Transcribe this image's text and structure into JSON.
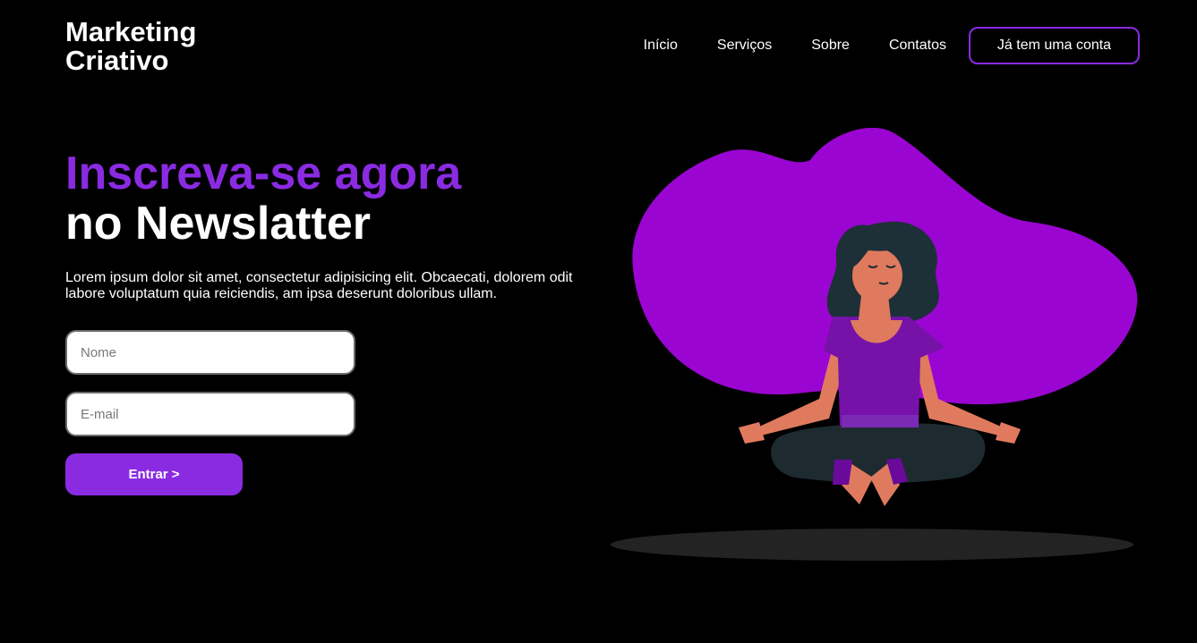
{
  "brand": {
    "line1": "Marketing",
    "line2": "Criativo"
  },
  "nav": {
    "items": [
      "Início",
      "Serviços",
      "Sobre",
      "Contatos"
    ],
    "account_button": "Já tem uma conta"
  },
  "hero": {
    "title_line1": "Inscreva-se agora",
    "title_line2": "no Newslatter",
    "description": "Lorem ipsum dolor sit amet, consectetur adipisicing elit. Obcaecati, dolorem odit labore voluptatum quia reiciendis, am ipsa deserunt doloribus ullam."
  },
  "form": {
    "name_placeholder": "Nome",
    "email_placeholder": "E-mail",
    "submit_label": "Entrar >"
  },
  "colors": {
    "accent": "#8a2be2",
    "blob": "#9b05d1",
    "background": "#000000"
  }
}
